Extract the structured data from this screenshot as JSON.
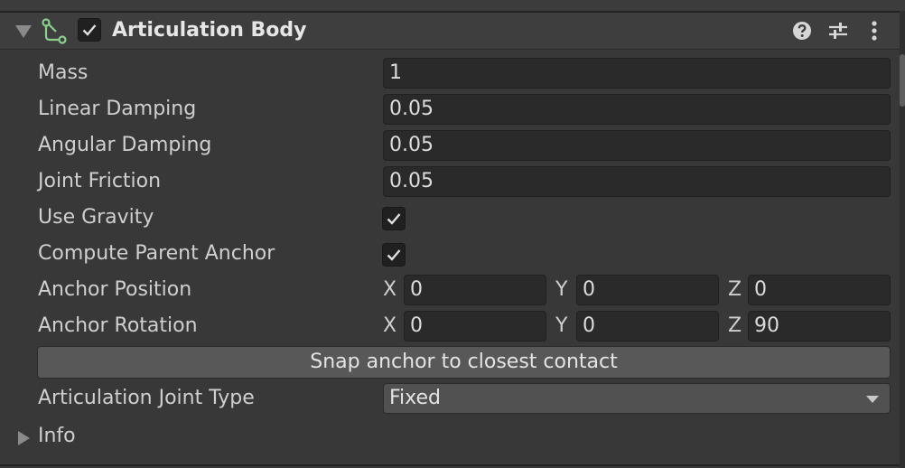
{
  "component": {
    "title": "Articulation Body",
    "enabled": true
  },
  "fields": {
    "mass": {
      "label": "Mass",
      "value": "1"
    },
    "linear_damping": {
      "label": "Linear Damping",
      "value": "0.05"
    },
    "angular_damping": {
      "label": "Angular Damping",
      "value": "0.05"
    },
    "joint_friction": {
      "label": "Joint Friction",
      "value": "0.05"
    },
    "use_gravity": {
      "label": "Use Gravity",
      "checked": true
    },
    "compute_parent_anchor": {
      "label": "Compute Parent Anchor",
      "checked": true
    },
    "anchor_position": {
      "label": "Anchor Position",
      "x_label": "X",
      "x": "0",
      "y_label": "Y",
      "y": "0",
      "z_label": "Z",
      "z": "0"
    },
    "anchor_rotation": {
      "label": "Anchor Rotation",
      "x_label": "X",
      "x": "0",
      "y_label": "Y",
      "y": "0",
      "z_label": "Z",
      "z": "90"
    },
    "snap_button": {
      "label": "Snap anchor to closest contact"
    },
    "joint_type": {
      "label": "Articulation Joint Type",
      "value": "Fixed"
    },
    "info": {
      "label": "Info"
    }
  },
  "icons": {
    "component": "articulation-body-icon",
    "help": "help-icon",
    "presets": "presets-icon",
    "menu": "kebab-menu-icon"
  },
  "colors": {
    "background": "#383838",
    "header": "#3e3e3e",
    "field": "#2a2a2a",
    "button": "#585858",
    "component_icon": "#8cd08c"
  }
}
